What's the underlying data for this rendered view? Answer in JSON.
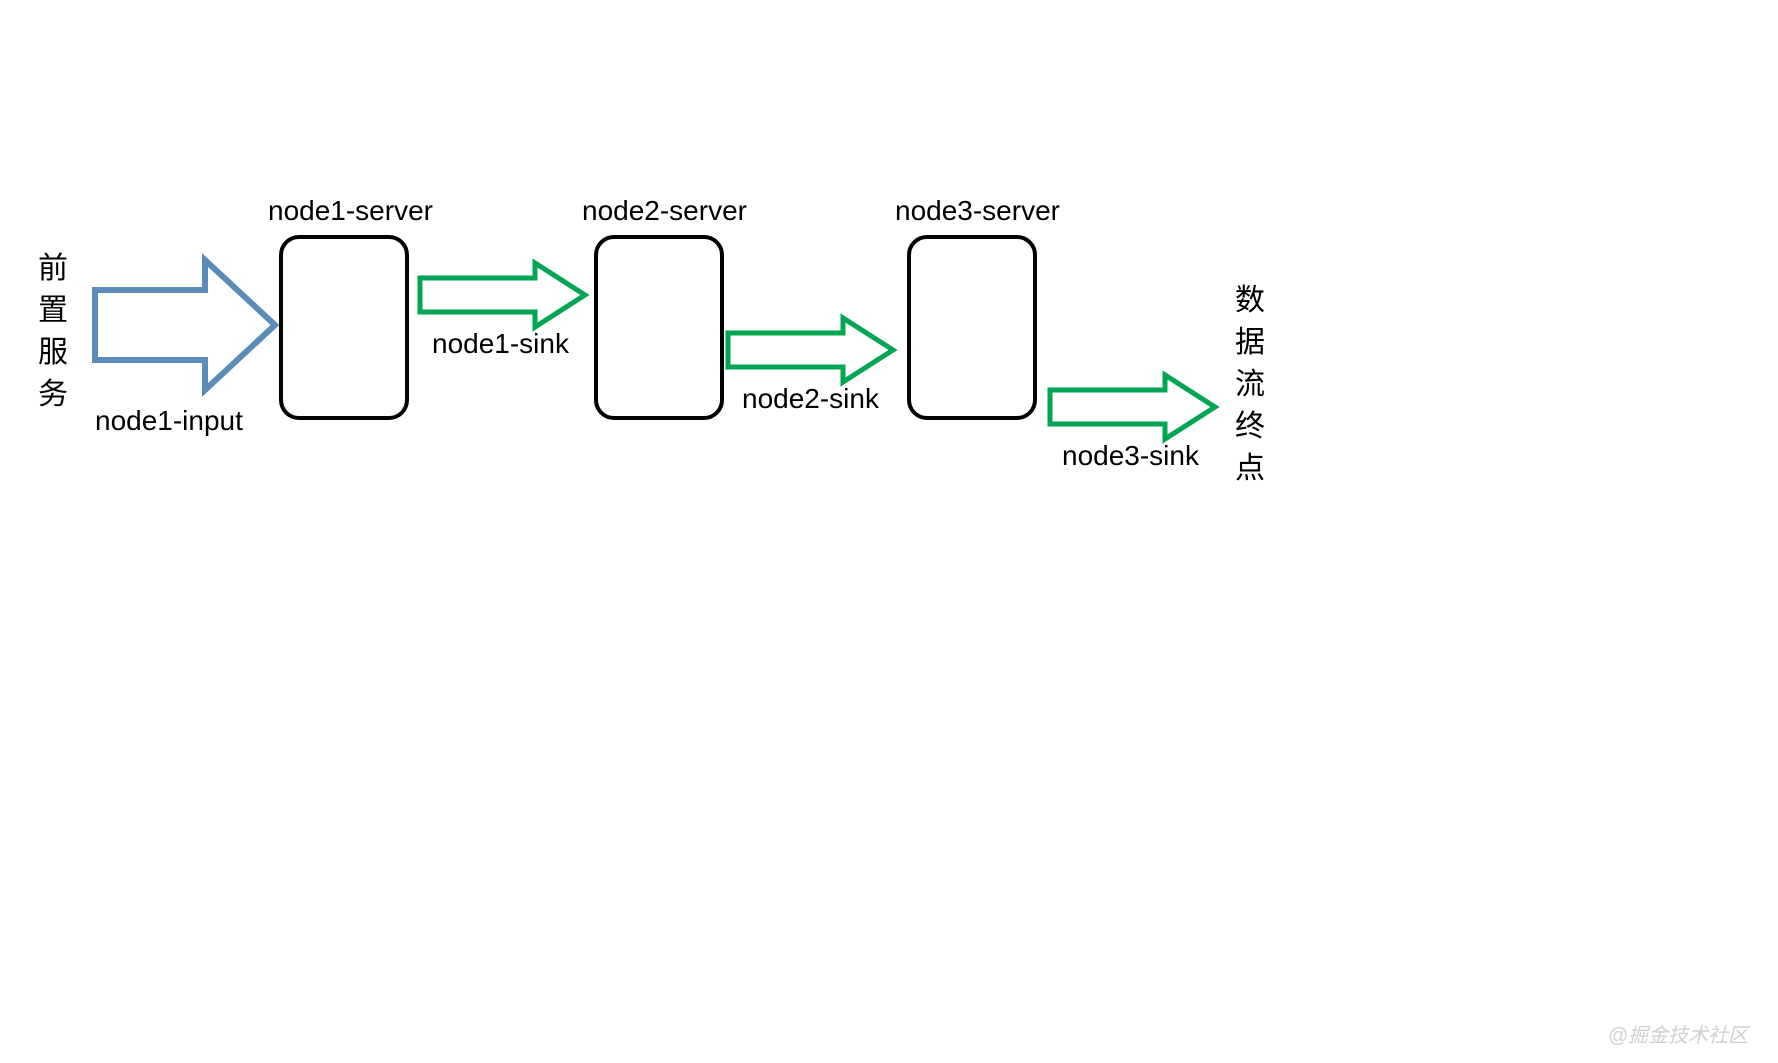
{
  "left_vertical_label": {
    "chars": [
      "前",
      "置",
      "服",
      "务"
    ]
  },
  "right_vertical_label": {
    "chars": [
      "数",
      "据",
      "流",
      "终",
      "点"
    ]
  },
  "nodes": {
    "node1": {
      "label": "node1-server"
    },
    "node2": {
      "label": "node2-server"
    },
    "node3": {
      "label": "node3-server"
    }
  },
  "arrows": {
    "input": {
      "label": "node1-input"
    },
    "sink1": {
      "label": "node1-sink"
    },
    "sink2": {
      "label": "node2-sink"
    },
    "sink3": {
      "label": "node3-sink"
    }
  },
  "watermark": "@掘金技术社区",
  "colors": {
    "blue_arrow": "#5b8bb8",
    "green_arrow": "#00a651",
    "box_border": "#000000"
  }
}
